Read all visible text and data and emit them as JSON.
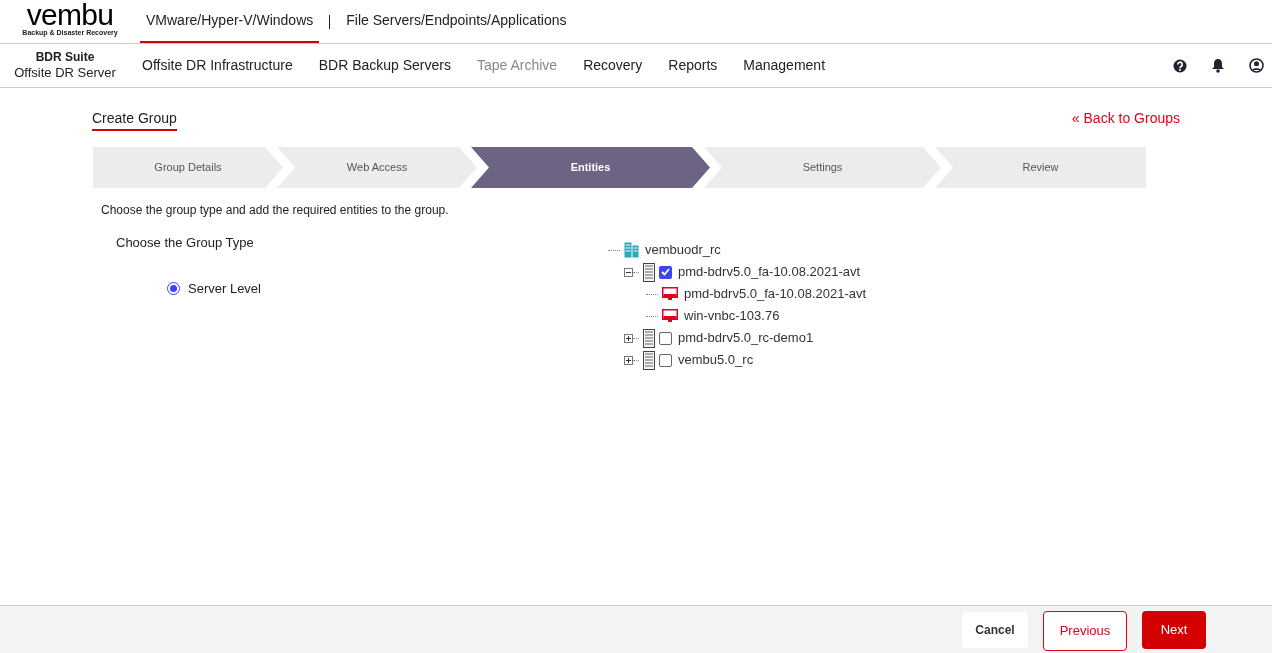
{
  "logo": {
    "wordmark": "vembu",
    "tagline": "Backup & Disaster Recovery"
  },
  "top_tabs": [
    {
      "label": "VMware/Hyper-V/Windows",
      "selected": true
    },
    {
      "label": "File Servers/Endpoints/Applications",
      "selected": false
    }
  ],
  "product": {
    "suite": "BDR Suite",
    "name": "Offsite DR Server"
  },
  "nav": [
    {
      "label": "Offsite DR Infrastructure",
      "disabled": false
    },
    {
      "label": "BDR Backup Servers",
      "disabled": false
    },
    {
      "label": "Tape Archive",
      "disabled": true
    },
    {
      "label": "Recovery",
      "disabled": false
    },
    {
      "label": "Reports",
      "disabled": false
    },
    {
      "label": "Management",
      "disabled": false
    }
  ],
  "page_title": "Create Group",
  "back_link": "« Back to Groups",
  "steps": [
    {
      "label": "Group Details",
      "selected": false
    },
    {
      "label": "Web Access",
      "selected": false
    },
    {
      "label": "Entities",
      "selected": true
    },
    {
      "label": "Settings",
      "selected": false
    },
    {
      "label": "Review",
      "selected": false
    }
  ],
  "instruction": "Choose the group type and add the required entities to the group.",
  "group_type": {
    "heading": "Choose the Group Type",
    "options": [
      {
        "label": "Server Level",
        "selected": true
      }
    ]
  },
  "tree": {
    "kind": "site",
    "label": "vembuodr_rc",
    "children": [
      {
        "kind": "server",
        "label": "pmd-bdrv5.0_fa-10.08.2021-avt",
        "checked": true,
        "expanded": true,
        "children": [
          {
            "kind": "vm",
            "label": "pmd-bdrv5.0_fa-10.08.2021-avt"
          },
          {
            "kind": "vm",
            "label": "win-vnbc-103.76"
          }
        ]
      },
      {
        "kind": "server",
        "label": "pmd-bdrv5.0_rc-demo1",
        "checked": false,
        "expanded": false
      },
      {
        "kind": "server",
        "label": "vembu5.0_rc",
        "checked": false,
        "expanded": false
      }
    ]
  },
  "footer": {
    "cancel": "Cancel",
    "previous": "Previous",
    "next": "Next"
  }
}
